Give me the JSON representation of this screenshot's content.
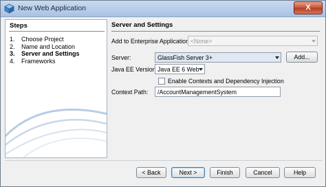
{
  "window": {
    "title": "New Web Application",
    "close_label": "X"
  },
  "steps": {
    "header": "Steps",
    "items": [
      {
        "num": "1.",
        "label": "Choose Project"
      },
      {
        "num": "2.",
        "label": "Name and Location"
      },
      {
        "num": "3.",
        "label": "Server and Settings"
      },
      {
        "num": "4.",
        "label": "Frameworks"
      }
    ]
  },
  "content": {
    "title": "Server and Settings",
    "enterprise_label": "Add to Enterprise Application:",
    "enterprise_value": "<None>",
    "server_label": "Server:",
    "server_value": "GlassFish Server 3+",
    "add_button": "Add...",
    "javaee_label": "Java EE Version:",
    "javaee_value": "Java EE 6 Web",
    "cdi_label": "Enable Contexts and Dependency Injection",
    "context_label": "Context Path:",
    "context_value": "/AccountManagementSystem"
  },
  "buttons": {
    "back": "< Back",
    "next": "Next >",
    "finish": "Finish",
    "cancel": "Cancel",
    "help": "Help"
  }
}
